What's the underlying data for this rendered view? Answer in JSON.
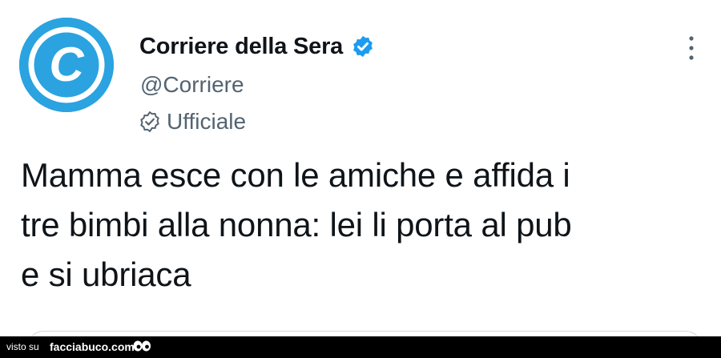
{
  "account": {
    "display_name": "Corriere della Sera",
    "handle": "@Corriere",
    "official_label": "Ufficiale",
    "avatar_letter": "C"
  },
  "tweet": {
    "lines": [
      "Mamma esce con le amiche e affida i",
      "tre bimbi alla nonna: lei li porta al pub",
      "e si ubriaca"
    ]
  },
  "icons": {
    "verified": "verified-badge-icon",
    "official": "official-check-icon",
    "more": "more-options-icon",
    "footer_logo": "eyes-logo-icon"
  },
  "footer": {
    "prefix": "visto su",
    "brand": "facciabuco.com"
  },
  "colors": {
    "avatar_blue": "#2aa3e0",
    "verified_blue": "#1d9bf0",
    "secondary_text": "#536471",
    "primary_text": "#0f1419"
  }
}
